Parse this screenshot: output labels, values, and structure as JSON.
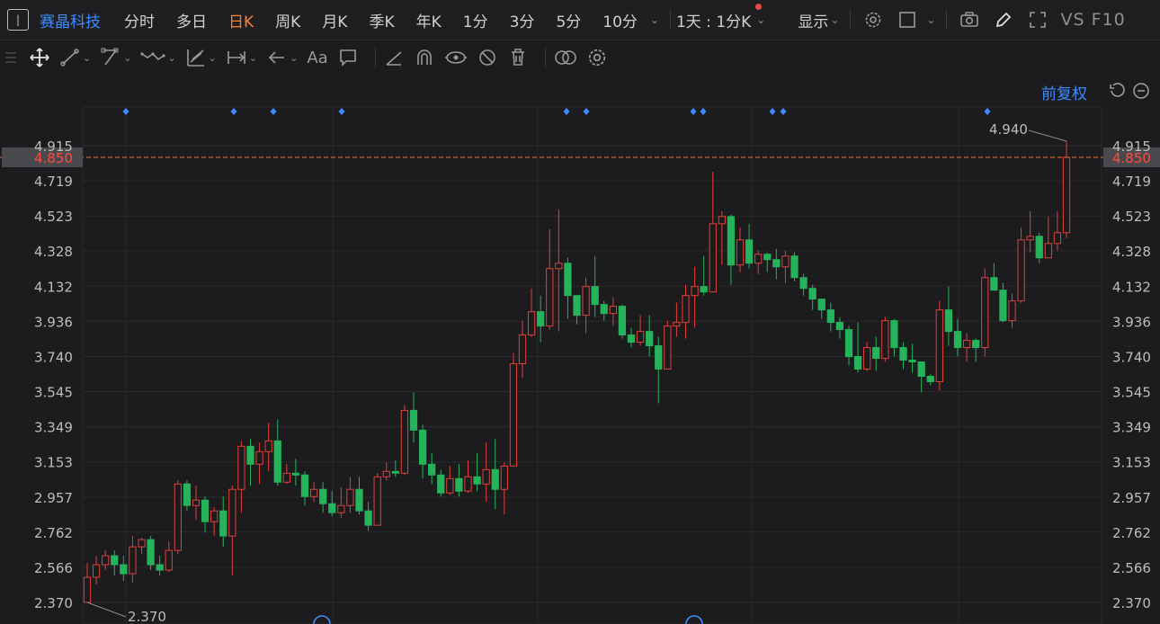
{
  "header": {
    "stock_name": "赛晶科技",
    "periods": [
      "分时",
      "多日",
      "日K",
      "周K",
      "月K",
      "季K",
      "年K",
      "1分",
      "3分",
      "5分",
      "10分"
    ],
    "active_period": "日K",
    "interval_label": "1天 : 1分K",
    "display_label": "显示",
    "vs_label": "VS",
    "f10_label": "F10"
  },
  "toolbar": {
    "tools": [
      "move-icon",
      "line-icon",
      "polyline-icon",
      "wave-icon",
      "channel-icon",
      "range-icon",
      "arrow-icon",
      "text-icon",
      "comment-icon",
      "ruler-icon",
      "magnet-icon",
      "eye-link-icon",
      "hide-icon",
      "trash-icon",
      "compare-icon",
      "settings-icon"
    ],
    "text_tool_label": "Aa"
  },
  "chart": {
    "adjust_label": "前复权",
    "current_price_label": "4.850",
    "max_label": "4.940",
    "min_label": "2.370",
    "colors": {
      "up": "#e0403a",
      "down": "#25b35b",
      "current_line": "#e8733a",
      "grid": "#2a2a2d",
      "marker": "#3d8bff"
    }
  },
  "chart_data": {
    "type": "candlestick",
    "yaxis_ticks": [
      "4.915",
      "4.719",
      "4.523",
      "4.328",
      "4.132",
      "3.936",
      "3.740",
      "3.545",
      "3.349",
      "3.153",
      "2.957",
      "2.762",
      "2.566",
      "2.370"
    ],
    "ylim": [
      2.37,
      4.915
    ],
    "current_price": 4.85,
    "max_price": 4.94,
    "min_price": 2.37,
    "candles": [
      [
        2.37,
        2.51,
        2.59,
        2.37
      ],
      [
        2.51,
        2.58,
        2.63,
        2.47
      ],
      [
        2.58,
        2.63,
        2.66,
        2.55
      ],
      [
        2.63,
        2.58,
        2.66,
        2.52
      ],
      [
        2.58,
        2.53,
        2.63,
        2.49
      ],
      [
        2.53,
        2.68,
        2.74,
        2.48
      ],
      [
        2.68,
        2.72,
        2.73,
        2.64
      ],
      [
        2.72,
        2.58,
        2.74,
        2.55
      ],
      [
        2.58,
        2.55,
        2.63,
        2.52
      ],
      [
        2.55,
        2.66,
        2.71,
        2.54
      ],
      [
        2.66,
        3.03,
        3.05,
        2.64
      ],
      [
        3.03,
        2.91,
        3.05,
        2.88
      ],
      [
        2.91,
        2.94,
        3.02,
        2.83
      ],
      [
        2.94,
        2.82,
        2.96,
        2.76
      ],
      [
        2.82,
        2.88,
        2.9,
        2.74
      ],
      [
        2.88,
        2.74,
        2.96,
        2.68
      ],
      [
        2.74,
        3.0,
        3.02,
        2.52
      ],
      [
        3.0,
        3.24,
        3.27,
        2.87
      ],
      [
        3.24,
        3.14,
        3.28,
        3.02
      ],
      [
        3.14,
        3.21,
        3.26,
        3.03
      ],
      [
        3.21,
        3.27,
        3.37,
        3.1
      ],
      [
        3.27,
        3.04,
        3.39,
        3.02
      ],
      [
        3.04,
        3.09,
        3.14,
        3.03
      ],
      [
        3.09,
        3.08,
        3.17,
        3.02
      ],
      [
        3.08,
        2.96,
        3.1,
        2.91
      ],
      [
        2.96,
        3.0,
        3.04,
        2.93
      ],
      [
        3.0,
        2.92,
        3.04,
        2.87
      ],
      [
        2.92,
        2.87,
        2.99,
        2.85
      ],
      [
        2.87,
        2.91,
        3.01,
        2.84
      ],
      [
        2.91,
        3.0,
        3.07,
        2.87
      ],
      [
        3.0,
        2.88,
        3.07,
        2.86
      ],
      [
        2.88,
        2.8,
        2.93,
        2.77
      ],
      [
        2.8,
        3.07,
        3.09,
        2.8
      ],
      [
        3.07,
        3.1,
        3.15,
        3.05
      ],
      [
        3.1,
        3.09,
        3.16,
        3.07
      ],
      [
        3.09,
        3.44,
        3.47,
        3.08
      ],
      [
        3.44,
        3.33,
        3.54,
        3.26
      ],
      [
        3.33,
        3.14,
        3.36,
        3.06
      ],
      [
        3.14,
        3.08,
        3.2,
        3.03
      ],
      [
        3.08,
        2.98,
        3.11,
        2.96
      ],
      [
        2.98,
        3.06,
        3.13,
        2.97
      ],
      [
        3.06,
        2.99,
        3.14,
        2.96
      ],
      [
        2.99,
        3.07,
        3.16,
        2.98
      ],
      [
        3.07,
        3.03,
        3.2,
        2.99
      ],
      [
        3.03,
        3.11,
        3.26,
        2.93
      ],
      [
        3.11,
        3.0,
        3.28,
        2.89
      ],
      [
        3.0,
        3.13,
        3.15,
        2.86
      ],
      [
        3.13,
        3.7,
        3.76,
        3.13
      ],
      [
        3.7,
        3.86,
        3.94,
        3.62
      ],
      [
        3.86,
        3.99,
        4.12,
        3.85
      ],
      [
        3.99,
        3.91,
        4.08,
        3.82
      ],
      [
        3.91,
        4.23,
        4.45,
        3.89
      ],
      [
        4.23,
        4.26,
        4.56,
        3.88
      ],
      [
        4.26,
        4.08,
        4.29,
        3.95
      ],
      [
        4.08,
        3.97,
        4.04,
        3.92
      ],
      [
        3.97,
        4.13,
        4.18,
        3.87
      ],
      [
        4.13,
        4.03,
        4.3,
        3.96
      ],
      [
        4.03,
        3.98,
        4.05,
        3.94
      ],
      [
        3.98,
        4.02,
        4.07,
        3.91
      ],
      [
        4.02,
        3.86,
        4.03,
        3.84
      ],
      [
        3.86,
        3.82,
        3.9,
        3.79
      ],
      [
        3.82,
        3.88,
        3.97,
        3.8
      ],
      [
        3.88,
        3.8,
        3.97,
        3.74
      ],
      [
        3.8,
        3.67,
        3.85,
        3.48
      ],
      [
        3.67,
        3.91,
        3.94,
        3.68
      ],
      [
        3.91,
        3.93,
        4.04,
        3.85
      ],
      [
        3.93,
        4.08,
        4.14,
        3.84
      ],
      [
        4.08,
        4.13,
        4.24,
        3.9
      ],
      [
        4.13,
        4.1,
        4.3,
        4.08
      ],
      [
        4.1,
        4.48,
        4.77,
        4.13
      ],
      [
        4.48,
        4.52,
        4.55,
        4.25
      ],
      [
        4.52,
        4.25,
        4.53,
        4.14
      ],
      [
        4.25,
        4.39,
        4.46,
        4.21
      ],
      [
        4.39,
        4.26,
        4.48,
        4.23
      ],
      [
        4.26,
        4.31,
        4.33,
        4.2
      ],
      [
        4.31,
        4.28,
        4.32,
        4.21
      ],
      [
        4.28,
        4.24,
        4.34,
        4.17
      ],
      [
        4.24,
        4.3,
        4.33,
        4.15
      ],
      [
        4.3,
        4.18,
        4.32,
        4.16
      ],
      [
        4.18,
        4.12,
        4.2,
        4.08
      ],
      [
        4.12,
        4.06,
        4.14,
        4.0
      ],
      [
        4.06,
        4.0,
        4.06,
        3.95
      ],
      [
        4.0,
        3.93,
        4.04,
        3.88
      ],
      [
        3.93,
        3.89,
        3.96,
        3.84
      ],
      [
        3.89,
        3.74,
        3.91,
        3.69
      ],
      [
        3.74,
        3.67,
        3.93,
        3.65
      ],
      [
        3.67,
        3.79,
        3.82,
        3.66
      ],
      [
        3.79,
        3.73,
        3.85,
        3.66
      ],
      [
        3.73,
        3.94,
        3.96,
        3.71
      ],
      [
        3.94,
        3.79,
        3.95,
        3.74
      ],
      [
        3.79,
        3.72,
        3.82,
        3.67
      ],
      [
        3.72,
        3.71,
        3.81,
        3.65
      ],
      [
        3.71,
        3.63,
        3.71,
        3.54
      ],
      [
        3.63,
        3.6,
        3.64,
        3.58
      ],
      [
        3.6,
        4.0,
        4.05,
        3.55
      ],
      [
        4.0,
        3.88,
        4.13,
        3.8
      ],
      [
        3.88,
        3.79,
        3.95,
        3.74
      ],
      [
        3.79,
        3.83,
        3.87,
        3.71
      ],
      [
        3.83,
        3.79,
        3.84,
        3.71
      ],
      [
        3.79,
        4.18,
        4.23,
        3.74
      ],
      [
        4.18,
        4.11,
        4.26,
        4.11
      ],
      [
        4.11,
        3.94,
        4.15,
        3.93
      ],
      [
        3.94,
        4.05,
        4.09,
        3.9
      ],
      [
        4.05,
        4.39,
        4.46,
        4.04
      ],
      [
        4.39,
        4.41,
        4.55,
        4.32
      ],
      [
        4.41,
        4.29,
        4.43,
        4.26
      ],
      [
        4.29,
        4.37,
        4.52,
        4.29
      ],
      [
        4.37,
        4.43,
        4.55,
        4.33
      ],
      [
        4.43,
        4.85,
        4.94,
        4.4
      ]
    ]
  }
}
